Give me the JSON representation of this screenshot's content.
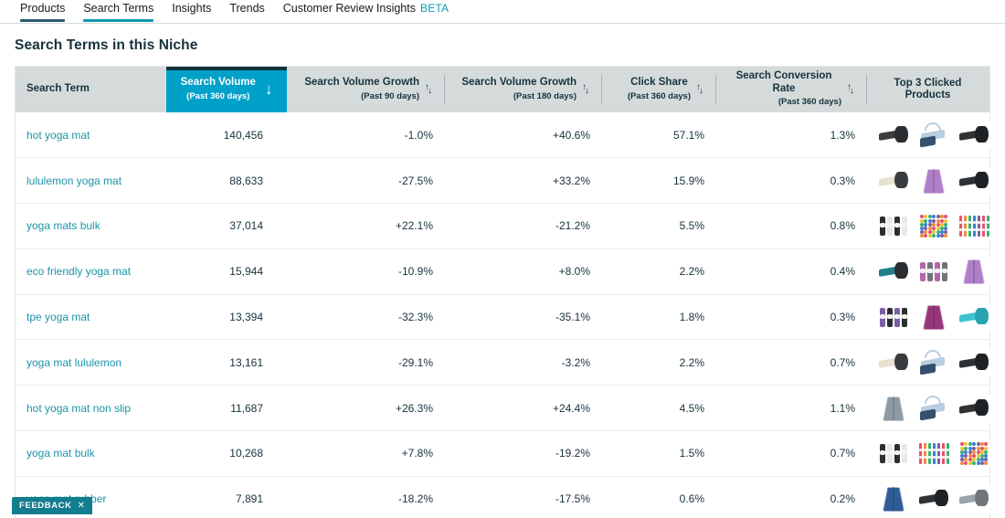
{
  "nav": {
    "tabs": [
      {
        "label": "Products",
        "state": "visited"
      },
      {
        "label": "Search Terms",
        "state": "active"
      },
      {
        "label": "Insights",
        "state": "normal"
      },
      {
        "label": "Trends",
        "state": "normal"
      },
      {
        "label": "Customer Review Insights",
        "state": "normal",
        "badge": "BETA"
      }
    ]
  },
  "page": {
    "title": "Search Terms in this Niche"
  },
  "colors": {
    "accent_teal": "#00a1c9",
    "link_teal": "#1b95a8",
    "header_bg": "#d5dbdb",
    "text_dark": "#16323c",
    "feedback_bg": "#127d8e"
  },
  "table": {
    "columns": [
      {
        "key": "term",
        "main": "Search Term",
        "sub": "",
        "sort": "none",
        "active": false
      },
      {
        "key": "vol",
        "main": "Search Volume",
        "sub": "(Past 360 days)",
        "sort": "desc",
        "active": true
      },
      {
        "key": "g90",
        "main": "Search Volume Growth",
        "sub": "(Past 90 days)",
        "sort": "both",
        "active": false
      },
      {
        "key": "g180",
        "main": "Search Volume Growth",
        "sub": "(Past 180 days)",
        "sort": "both",
        "active": false
      },
      {
        "key": "click",
        "main": "Click Share",
        "sub": "(Past 360 days)",
        "sort": "both",
        "active": false
      },
      {
        "key": "conv",
        "main": "Search Conversion Rate",
        "sub": "(Past 360 days)",
        "sort": "both",
        "active": false
      },
      {
        "key": "top3",
        "main": "Top 3 Clicked Products",
        "sub": "",
        "sort": "none",
        "active": false
      }
    ],
    "sort_icon_desc": "↓",
    "sort_icon_up": "↑",
    "sort_icon_down": "↓",
    "rows": [
      {
        "term": "hot yoga mat",
        "vol": "140,456",
        "g90": "-1.0%",
        "g180": "+40.6%",
        "click": "57.1%",
        "conv": "1.3%"
      },
      {
        "term": "lululemon yoga mat",
        "vol": "88,633",
        "g90": "-27.5%",
        "g180": "+33.2%",
        "click": "15.9%",
        "conv": "0.3%"
      },
      {
        "term": "yoga mats bulk",
        "vol": "37,014",
        "g90": "+22.1%",
        "g180": "-21.2%",
        "click": "5.5%",
        "conv": "0.8%"
      },
      {
        "term": "eco friendly yoga mat",
        "vol": "15,944",
        "g90": "-10.9%",
        "g180": "+8.0%",
        "click": "2.2%",
        "conv": "0.4%"
      },
      {
        "term": "tpe yoga mat",
        "vol": "13,394",
        "g90": "-32.3%",
        "g180": "-35.1%",
        "click": "1.8%",
        "conv": "0.3%"
      },
      {
        "term": "yoga mat lululemon",
        "vol": "13,161",
        "g90": "-29.1%",
        "g180": "-3.2%",
        "click": "2.2%",
        "conv": "0.7%"
      },
      {
        "term": "hot yoga mat non slip",
        "vol": "11,687",
        "g90": "+26.3%",
        "g180": "+24.4%",
        "click": "4.5%",
        "conv": "1.1%"
      },
      {
        "term": "yoga mat bulk",
        "vol": "10,268",
        "g90": "+7.8%",
        "g180": "-19.2%",
        "click": "1.5%",
        "conv": "0.7%"
      },
      {
        "term": "yoga mat rubber",
        "vol": "7,891",
        "g90": "-18.2%",
        "g180": "-17.5%",
        "click": "0.6%",
        "conv": "0.2%"
      }
    ],
    "thumbnails": [
      [
        {
          "kind": "mat-roll",
          "c1": "#3b3f42",
          "c2": "#2b2e30"
        },
        {
          "kind": "sling",
          "c1": "#b9cde0",
          "c2": "#35506e"
        },
        {
          "kind": "mat-roll",
          "c1": "#2f3336",
          "c2": "#1f2224"
        }
      ],
      [
        {
          "kind": "mat-roll",
          "c1": "#e8e1cf",
          "c2": "#3a3d3f"
        },
        {
          "kind": "mat-flat",
          "c1": "#b07fc9",
          "c2": "#8f5fae"
        },
        {
          "kind": "mat-roll",
          "c1": "#2f3336",
          "c2": "#1f2224"
        }
      ],
      [
        {
          "kind": "tubes",
          "c1": "#2b2e30",
          "c2": "#e8e8e8"
        },
        {
          "kind": "poster",
          "c1": "#e8506e",
          "c2": "#36b36b"
        },
        {
          "kind": "strips",
          "c1": "#e8506e",
          "c2": "#3a7fd5"
        }
      ],
      [
        {
          "kind": "mat-roll",
          "c1": "#1f7f8c",
          "c2": "#2b2e30"
        },
        {
          "kind": "tubes",
          "c1": "#b565a8",
          "c2": "#6f7478"
        },
        {
          "kind": "mat-flat",
          "c1": "#b07fc9",
          "c2": "#7d5fa0"
        }
      ],
      [
        {
          "kind": "tubes",
          "c1": "#7b5fa5",
          "c2": "#2b2e30"
        },
        {
          "kind": "mat-flat",
          "c1": "#96367b",
          "c2": "#7d2b66"
        },
        {
          "kind": "mat-roll",
          "c1": "#3fc2cf",
          "c2": "#2aa3b0"
        }
      ],
      [
        {
          "kind": "mat-roll",
          "c1": "#e8e1cf",
          "c2": "#3a3d3f"
        },
        {
          "kind": "sling",
          "c1": "#b9cde0",
          "c2": "#35506e"
        },
        {
          "kind": "mat-roll",
          "c1": "#2f3336",
          "c2": "#1f2224"
        }
      ],
      [
        {
          "kind": "mat-flat",
          "c1": "#8e9aa3",
          "c2": "#6d7780"
        },
        {
          "kind": "sling",
          "c1": "#b9cde0",
          "c2": "#35506e"
        },
        {
          "kind": "mat-roll",
          "c1": "#2f3336",
          "c2": "#1f2224"
        }
      ],
      [
        {
          "kind": "tubes",
          "c1": "#2b2e30",
          "c2": "#e8e8e8"
        },
        {
          "kind": "strips",
          "c1": "#e8506e",
          "c2": "#3a7fd5"
        },
        {
          "kind": "poster",
          "c1": "#e8506e",
          "c2": "#36b36b"
        }
      ],
      [
        {
          "kind": "mat-flat",
          "c1": "#2f5c96",
          "c2": "#23477a"
        },
        {
          "kind": "mat-roll",
          "c1": "#2f3336",
          "c2": "#1f2224"
        },
        {
          "kind": "mat-roll",
          "c1": "#9aa3ab",
          "c2": "#6f767c"
        }
      ]
    ]
  },
  "feedback": {
    "label": "FEEDBACK",
    "close": "✕"
  }
}
